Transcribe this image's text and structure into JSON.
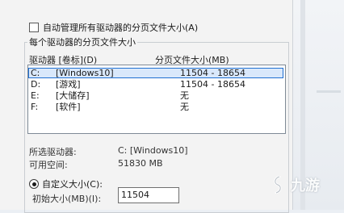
{
  "auto_manage": {
    "label": "自动管理所有驱动器的分页文件大小(A)",
    "checked": false
  },
  "group": {
    "title": "每个驱动器的分页文件大小"
  },
  "columns": {
    "drive": "驱动器 [卷标](D)",
    "size": "分页文件大小(MB)"
  },
  "drives": [
    {
      "letter": "C:",
      "label": "[Windows10]",
      "size": "11504 - 18654"
    },
    {
      "letter": "D:",
      "label": "[游戏]",
      "size": "11504 - 18654"
    },
    {
      "letter": "E:",
      "label": "[大储存]",
      "size": "无"
    },
    {
      "letter": "F:",
      "label": "[软件]",
      "size": "无"
    }
  ],
  "selected_drive": {
    "label": "所选驱动器:",
    "value": "C:  [Windows10]"
  },
  "free_space": {
    "label": "可用空间:",
    "value": "51830 MB"
  },
  "custom_size": {
    "label": "自定义大小(C):",
    "selected": true
  },
  "initial_size": {
    "label": "初始大小(MB)(I):",
    "value": "11504"
  },
  "watermark": {
    "text": "九游"
  }
}
